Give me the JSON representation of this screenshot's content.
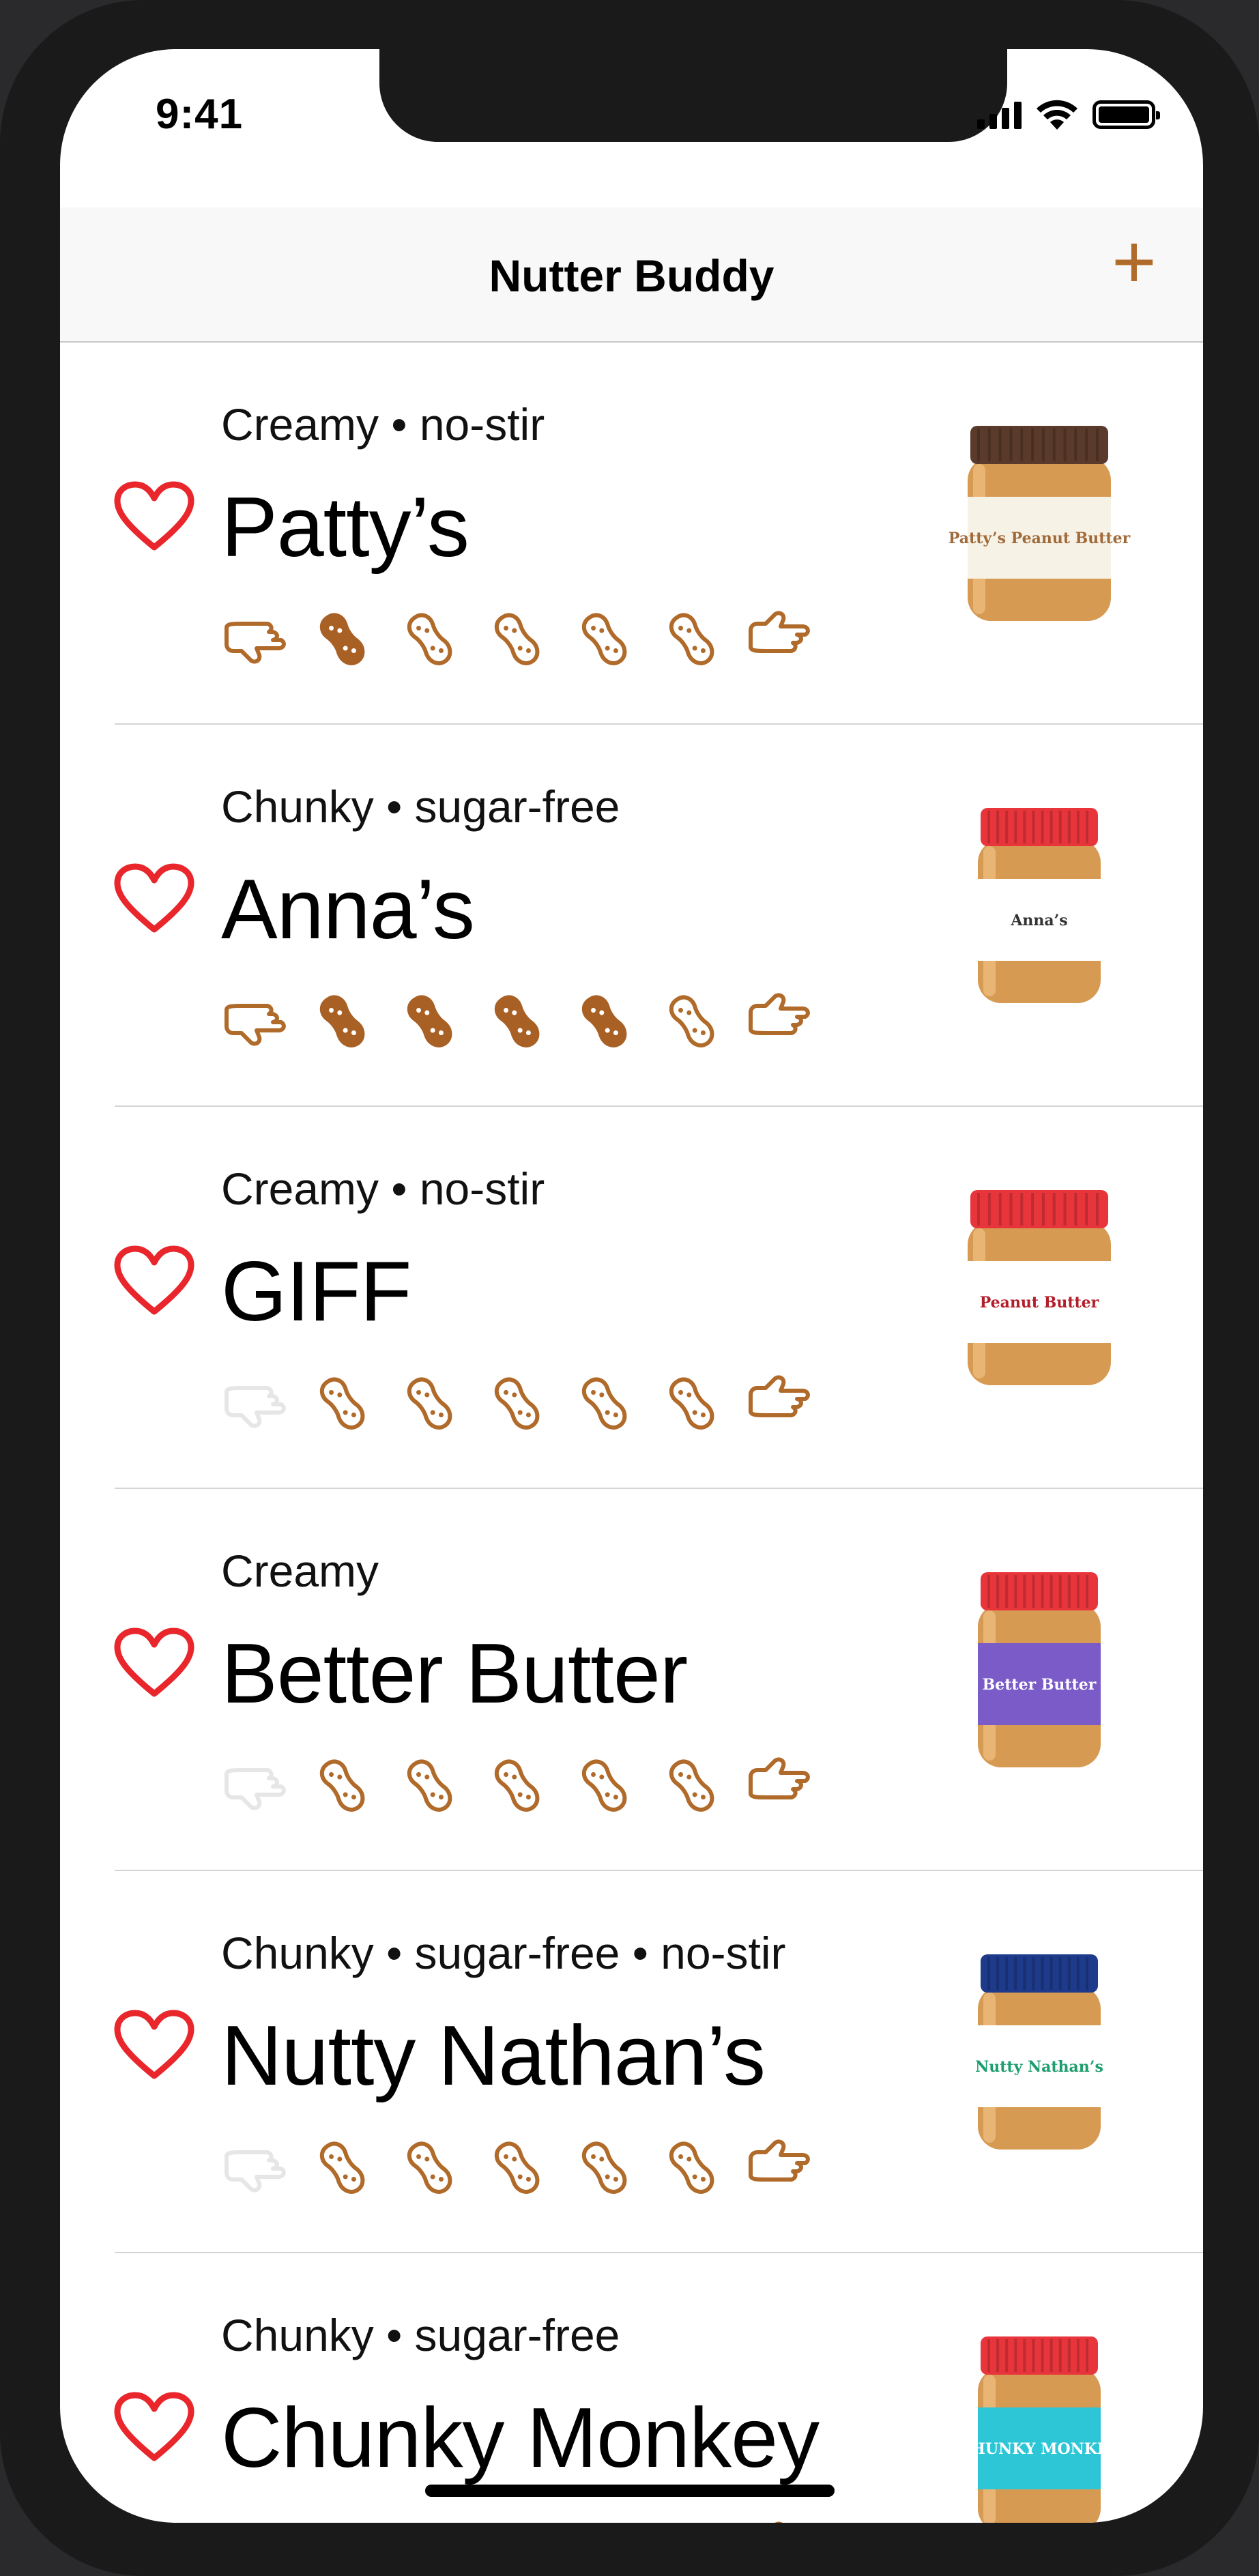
{
  "status_bar": {
    "time": "9:41"
  },
  "nav": {
    "title": "Nutter Buddy",
    "add_label": "+"
  },
  "colors": {
    "accent": "#b06a2a",
    "peanut_fill": "#a86024",
    "heart": "#e8262b",
    "thumb_inactive": "#e6e6e6"
  },
  "items": [
    {
      "subtitle": "Creamy • no-stir",
      "name": "Patty’s",
      "rating": 1,
      "thumb_down": true,
      "jar": {
        "lid": "#5a3a2a",
        "label": "#f7f2e6",
        "label_text": "Patty’s Peanut Butter",
        "text": "#a06a3a",
        "shape": "wide"
      }
    },
    {
      "subtitle": "Chunky • sugar-free",
      "name": "Anna’s",
      "rating": 4,
      "thumb_down": true,
      "jar": {
        "lid": "#e8353c",
        "label": "#ffffff",
        "label_text": "Anna’s",
        "text": "#333333",
        "shape": "tall"
      }
    },
    {
      "subtitle": "Creamy • no-stir",
      "name": "GIFF",
      "rating": 0,
      "thumb_down": false,
      "jar": {
        "lid": "#e8353c",
        "label": "#ffffff",
        "label_text": "Peanut Butter",
        "text": "#b21e2a",
        "shape": "wide"
      }
    },
    {
      "subtitle": "Creamy",
      "name": "Better Butter",
      "rating": 0,
      "thumb_down": false,
      "jar": {
        "lid": "#e8353c",
        "label": "#7b5bc7",
        "label_text": "Better Butter",
        "text": "#ffffff",
        "shape": "tall"
      }
    },
    {
      "subtitle": "Chunky • sugar-free • no-stir",
      "name": "Nutty Nathan’s",
      "rating": 0,
      "thumb_down": false,
      "jar": {
        "lid": "#1e3a8a",
        "label": "#ffffff",
        "label_text": "Nutty Nathan’s",
        "text": "#1e9e6e",
        "shape": "tall"
      }
    },
    {
      "subtitle": "Chunky • sugar-free",
      "name": "Chunky Monkey",
      "rating": 0,
      "thumb_down": false,
      "jar": {
        "lid": "#e8353c",
        "label": "#2cc6d6",
        "label_text": "CHUNKY MONKEY",
        "text": "#ffffff",
        "shape": "tall"
      }
    }
  ]
}
